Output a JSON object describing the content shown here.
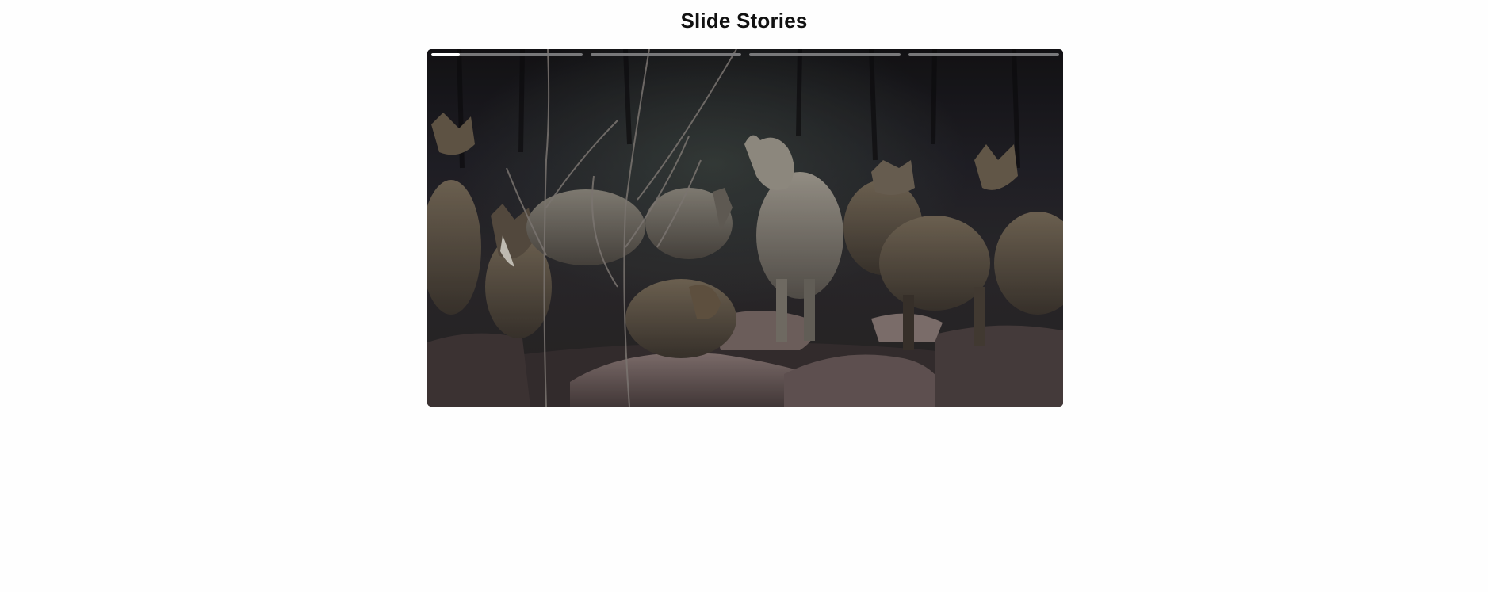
{
  "page": {
    "title": "Slide Stories"
  },
  "story": {
    "image_subject": "wolf-pack-photo",
    "slides": [
      {
        "progress": 0.19
      },
      {
        "progress": 0
      },
      {
        "progress": 0
      },
      {
        "progress": 0
      }
    ],
    "colors": {
      "progress_active": "#ffffff",
      "progress_inactive": "#78787a"
    }
  }
}
